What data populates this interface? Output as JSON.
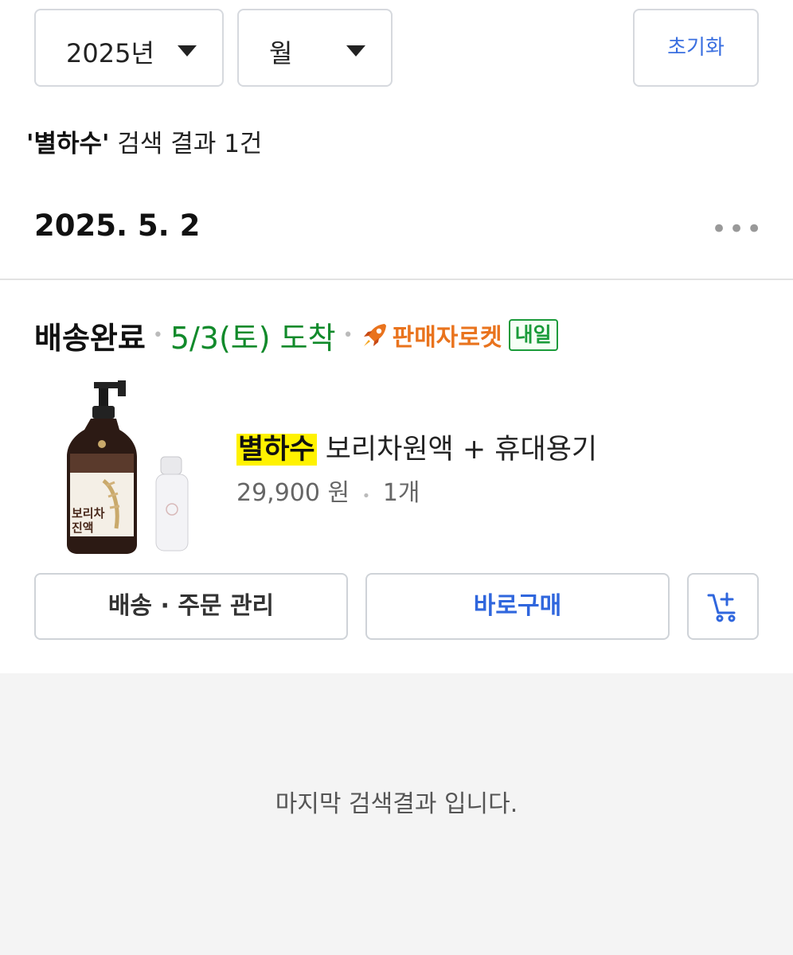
{
  "filters": {
    "year_label": "2025년",
    "month_label": "월",
    "reset_label": "초기화"
  },
  "search": {
    "query_display": "'별하수'",
    "result_text": " 검색 결과 1건"
  },
  "order": {
    "date": "2025. 5. 2",
    "more_icon": "more-dots-icon",
    "status": "배송완료",
    "arrival": "5/3(토) 도착",
    "rocket_label": "판매자로켓",
    "tomorrow_badge": "내일",
    "product": {
      "name_highlight": "별하수",
      "name_rest": " 보리차원액 + 휴대용기",
      "price": "29,900 원",
      "quantity": "1개",
      "image_text_line1": "보리차",
      "image_text_line2": "진액"
    },
    "buttons": {
      "manage": "배송 · 주문 관리",
      "buy": "바로구매",
      "cart_icon": "add-to-cart-icon"
    }
  },
  "footer": {
    "last_text": "마지막 검색결과 입니다."
  },
  "colors": {
    "accent_blue": "#2f66dd",
    "arrival_green": "#118a2b",
    "rocket_orange": "#e9731d",
    "highlight_yellow": "#fff200"
  }
}
